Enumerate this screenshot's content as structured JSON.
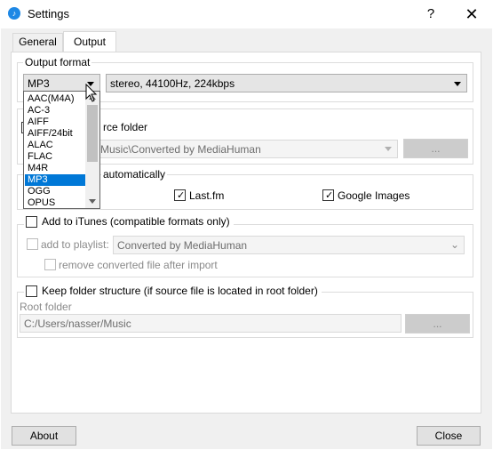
{
  "window": {
    "title": "Settings",
    "help": "?",
    "close": "✕"
  },
  "tabs": [
    {
      "label": "General"
    },
    {
      "label": "Output"
    }
  ],
  "output_format": {
    "legend": "Output format",
    "format_value": "MP3",
    "quality_value": "stereo, 44100Hz, 224kbps",
    "options": [
      "AAC(M4A)",
      "AC-3",
      "AIFF",
      "AIFF/24bit",
      "ALAC",
      "FLAC",
      "M4R",
      "MP3",
      "OGG",
      "OPUS"
    ],
    "selected": "MP3"
  },
  "folder": {
    "label_partial": "rce folder",
    "path_partial": "Music\\Converted by MediaHuman",
    "browse": "..."
  },
  "covers": {
    "label_partial": "automatically",
    "lastfm": "Last.fm",
    "google": "Google Images"
  },
  "itunes": {
    "label": "Add to iTunes (compatible formats only)",
    "playlist_label": "add to playlist:",
    "playlist_value": "Converted by MediaHuman",
    "remove_label": "remove converted file after import"
  },
  "keep_structure": {
    "label": "Keep folder structure (if source file is located in root folder)",
    "root_label": "Root folder",
    "root_path": "C:/Users/nasser/Music",
    "browse": "..."
  },
  "footer": {
    "about": "About",
    "close": "Close"
  }
}
